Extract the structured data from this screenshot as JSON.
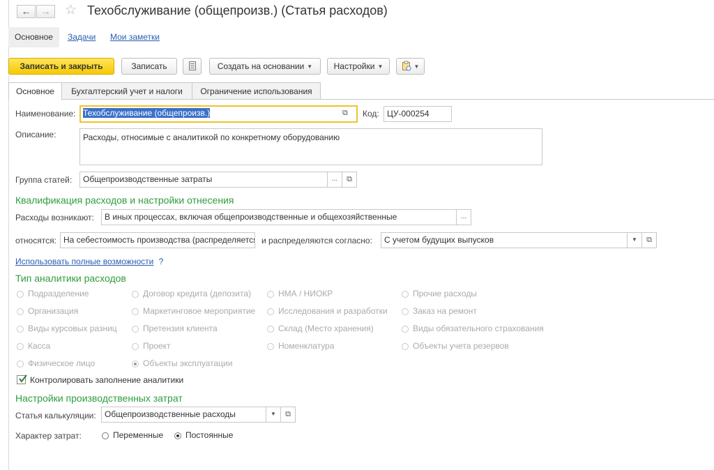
{
  "window": {
    "title": "Техобслуживание (общепроизв.) (Статья расходов)",
    "back_icon": "arrow-left-icon",
    "forward_icon": "arrow-right-icon",
    "favorite_icon": "star-icon"
  },
  "section_tabs": [
    {
      "label": "Основное",
      "active": true
    },
    {
      "label": "Задачи",
      "active": false
    },
    {
      "label": "Мои заметки",
      "active": false
    }
  ],
  "toolbar": {
    "save_close": "Записать и закрыть",
    "save": "Записать",
    "create_based": "Создать на основании",
    "settings": "Настройки"
  },
  "form_tabs": [
    {
      "label": "Основное",
      "active": true
    },
    {
      "label": "Бухгалтерский учет и налоги",
      "active": false
    },
    {
      "label": "Ограничение использования",
      "active": false
    }
  ],
  "form": {
    "name_label": "Наименование:",
    "name_value": "Техобслуживание (общепроизв.)",
    "code_label": "Код:",
    "code_value": "ЦУ-000254",
    "description_label": "Описание:",
    "description_value": "Расходы, относимые с аналитикой по конкретному оборудованию",
    "group_label": "Группа статей:",
    "group_value": "Общепроизводственные затраты"
  },
  "qualification": {
    "heading": "Квалификация расходов и настройки отнесения",
    "arise_label": "Расходы возникают:",
    "arise_value": "В иных процессах, включая общепроизводственные и общехозяйственные",
    "relate_label": "относятся:",
    "relate_value": "На себестоимость производства (распределяется)",
    "distribute_label": "и распределяются согласно:",
    "distribute_value": "С учетом будущих выпусков",
    "full_link": "Использовать полные возможности",
    "help": "?"
  },
  "analytics": {
    "heading": "Тип аналитики расходов",
    "columns": [
      [
        "Подразделение",
        "Организация",
        "Виды курсовых разниц",
        "Касса",
        "Физическое лицо"
      ],
      [
        "Договор кредита (депозита)",
        "Маркетинговое мероприятие",
        "Претензия клиента",
        "Проект",
        "Объекты эксплуатации"
      ],
      [
        "НМА / НИОКР",
        "Исследования и разработки",
        "Склад (Место хранения)",
        "Номенклатура"
      ],
      [
        "Прочие расходы",
        "Заказ на ремонт",
        "Виды обязательного страхования",
        "Объекты учета резервов"
      ]
    ],
    "selected": "Объекты эксплуатации",
    "control_label": "Контролировать заполнение аналитики",
    "control_checked": true
  },
  "production": {
    "heading": "Настройки производственных затрат",
    "calc_label": "Статья калькуляции:",
    "calc_value": "Общепроизводственные расходы",
    "nature_label": "Характер затрат:",
    "options": [
      "Переменные",
      "Постоянные"
    ],
    "selected": "Постоянные"
  },
  "colors": {
    "accent_yellow": "#f6c900",
    "section_green": "#2e9d3e",
    "link_blue": "#2a5db0",
    "selection_blue": "#3a70c9"
  }
}
